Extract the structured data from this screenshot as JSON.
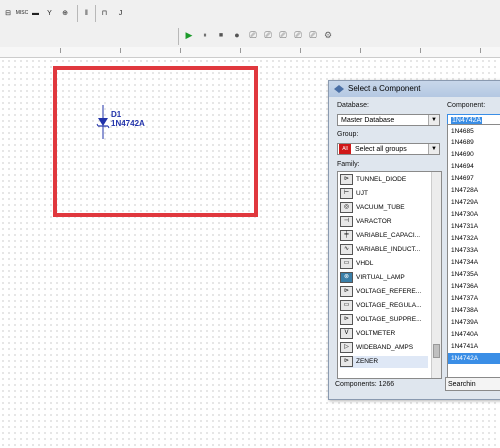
{
  "toolbar": {
    "buttons": [
      "⊟",
      "MISC",
      "▬",
      "Y",
      "⊕",
      "‖",
      "⊓",
      "J"
    ]
  },
  "simulation": {
    "run_icon": "▶",
    "pause_icon": "⏸",
    "stop_icon": "■"
  },
  "schematic": {
    "part_ref": "D1",
    "part_value": "1N4742A"
  },
  "dialog": {
    "title": "Select a Component",
    "database_label": "Database:",
    "database_value": "Master Database",
    "group_label": "Group:",
    "group_icon_text": "All",
    "group_value": "Select all groups",
    "family_label": "Family:",
    "component_label": "Component:",
    "component_value": "1N4742A",
    "families": [
      "TUNNEL_DIODE",
      "UJT",
      "VACUUM_TUBE",
      "VARACTOR",
      "VARIABLE_CAPACI...",
      "VARIABLE_INDUCT...",
      "VHDL",
      "VIRTUAL_LAMP",
      "VOLTAGE_REFERE...",
      "VOLTAGE_REGULA...",
      "VOLTAGE_SUPPRE...",
      "VOLTMETER",
      "WIDEBAND_AMPS",
      "ZENER"
    ],
    "components": [
      "1N4685",
      "1N4689",
      "1N4690",
      "1N4694",
      "1N4697",
      "1N4728A",
      "1N4729A",
      "1N4730A",
      "1N4731A",
      "1N4732A",
      "1N4733A",
      "1N4734A",
      "1N4735A",
      "1N4736A",
      "1N4737A",
      "1N4738A",
      "1N4739A",
      "1N4740A",
      "1N4741A",
      "1N4742A"
    ],
    "components_count": "Components: 1266",
    "search_button": "Searchin"
  },
  "colors": {
    "highlight": "#e0383e",
    "selection": "#3a8ee6",
    "part_label": "#2233aa"
  }
}
